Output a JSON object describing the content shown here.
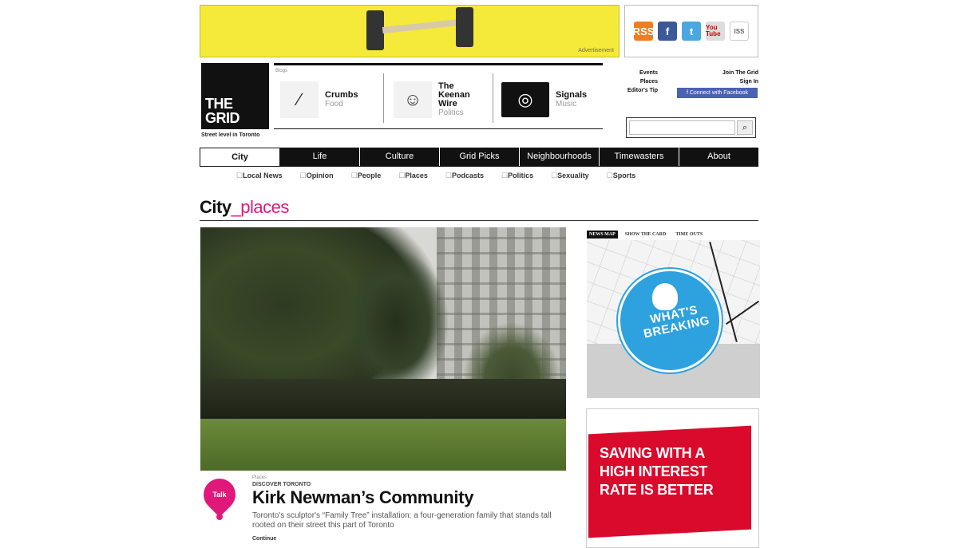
{
  "ads": {
    "top_banner_tag": "Advertisement",
    "bank_ad_text": "SAVING WITH A HIGH INTEREST RATE IS BETTER"
  },
  "social": {
    "rss": "RSS",
    "facebook": "f",
    "twitter": "t",
    "youtube": "You Tube",
    "misc": "ISS"
  },
  "logo": {
    "line1": "THE",
    "line2": "GRID",
    "tagline": "Street level in Toronto"
  },
  "blogs": {
    "label": "Blogs",
    "items": [
      {
        "title": "Crumbs",
        "subtitle": "Food"
      },
      {
        "title": "The Keenan Wire",
        "subtitle": "Politics"
      },
      {
        "title": "Signals",
        "subtitle": "Music"
      }
    ]
  },
  "quick_links": [
    "Events",
    "Places",
    "Editor's Tip"
  ],
  "account_links": [
    "Join The Grid",
    "Sign In"
  ],
  "facebook_button": "f Connect with Facebook",
  "search": {
    "placeholder": "",
    "button_icon": "search-icon"
  },
  "nav": {
    "tabs": [
      "City",
      "Life",
      "Culture",
      "Grid Picks",
      "Neighbourhoods",
      "Timewasters",
      "About"
    ],
    "active": "City",
    "subtabs": [
      "Local News",
      "Opinion",
      "People",
      "Places",
      "Podcasts",
      "Politics",
      "Sexuality",
      "Sports"
    ]
  },
  "page": {
    "title_main": "City",
    "title_accent": "_places"
  },
  "article": {
    "badge": "Talk",
    "section": "Places",
    "kicker": "DISCOVER TORONTO",
    "headline": "Kirk Newman’s Community",
    "dek": "Toronto's sculptor's “Family Tree” installation: a four-generation family that stands tall rooted on their street this part of Toronto",
    "more": "Continue"
  },
  "sidebar": {
    "map_tabs": [
      "NEWS MAP",
      "SHOW THE CARD",
      "TIME OUTS"
    ],
    "map_badge_text": "WHAT'S BREAKING"
  },
  "colors": {
    "accent": "#e0187a",
    "ad_yellow": "#f5e93a",
    "nav_black": "#111111",
    "map_blue": "#2ea2de",
    "bank_red": "#d90a2c"
  }
}
